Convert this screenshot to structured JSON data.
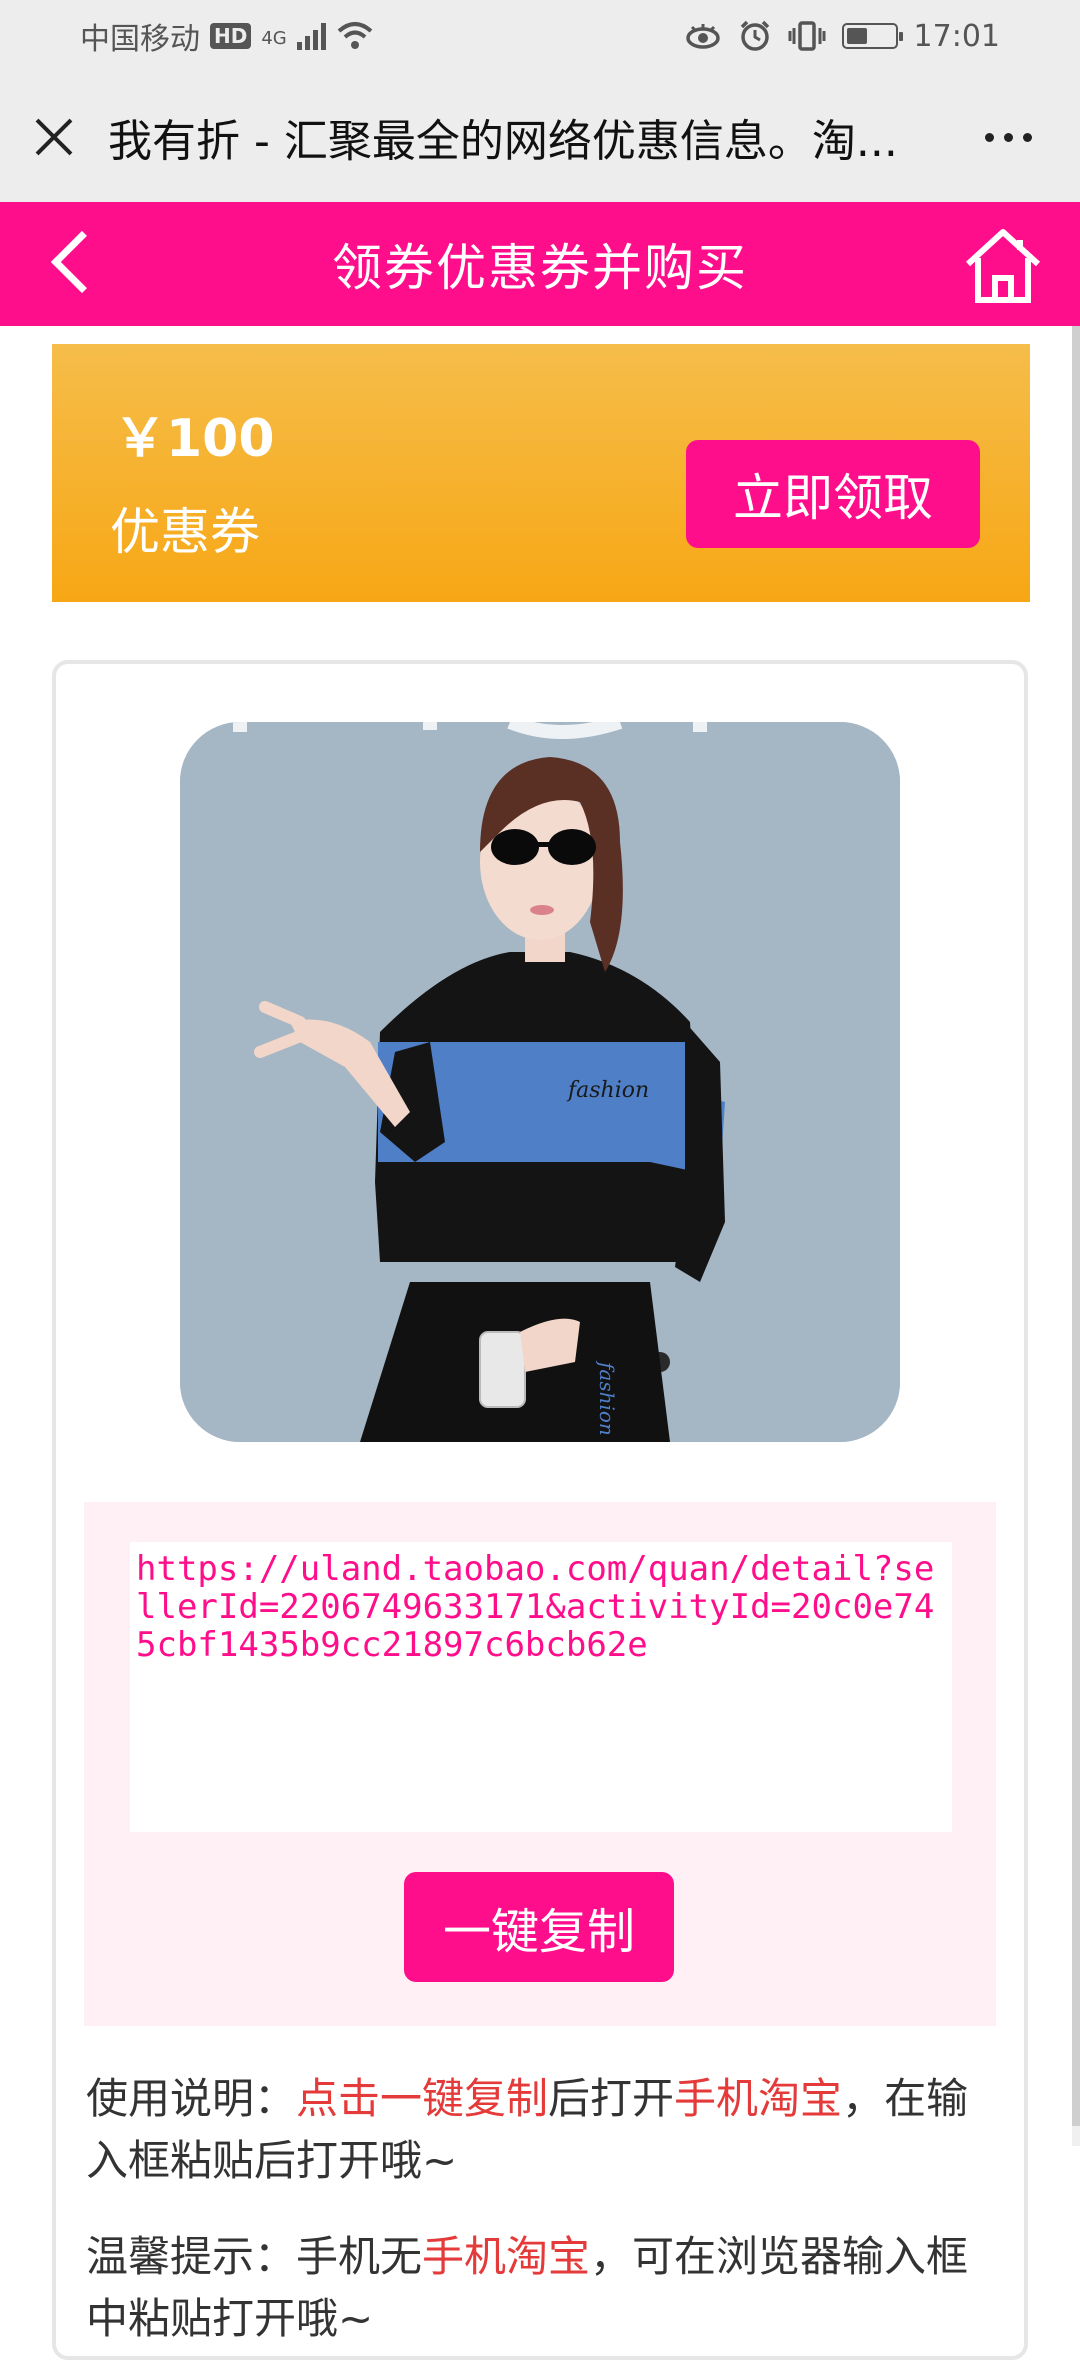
{
  "status": {
    "carrier": "中国移动",
    "hd": "HD",
    "network": "4G",
    "time": "17:01"
  },
  "browser": {
    "title": "我有折 - 汇聚最全的网络优惠信息。淘..."
  },
  "header": {
    "title": "领券优惠券并购买"
  },
  "coupon": {
    "amount": "￥100",
    "label": "优惠券",
    "claim_label": "立即领取"
  },
  "link": {
    "url": "https://uland.taobao.com/quan/detail?sellerId=2206749633171&activityId=20c0e745cbf1435b9cc21897c6bcb62e",
    "copy_label": "一键复制"
  },
  "instructions": {
    "usage_prefix": "使用说明：",
    "usage_hl1": "点击一键复制",
    "usage_mid": "后打开",
    "usage_hl2": "手机淘宝",
    "usage_suffix": "，在输入框粘贴后打开哦~",
    "tip_prefix": "温馨提示：手机无",
    "tip_hl": "手机淘宝",
    "tip_suffix": "，可在浏览器输入框中粘贴打开哦~"
  },
  "product": {
    "print_text": "fashion"
  },
  "colors": {
    "accent": "#ff0e8c",
    "coupon_bg": "#f7a715",
    "highlight": "#e53a3a"
  }
}
